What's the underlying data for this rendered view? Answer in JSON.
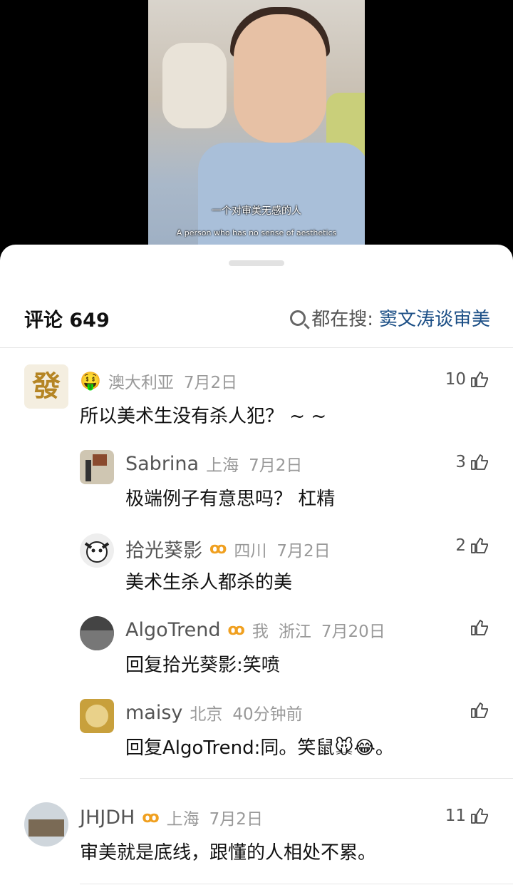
{
  "video": {
    "caption_cn": "一个对审美无感的人",
    "caption_en": "A person who has no sense of aesthetics"
  },
  "header": {
    "title": "评论 649",
    "search_prefix": "都在搜:",
    "search_term": "窦文涛谈审美"
  },
  "comments": [
    {
      "avatar_icon": "fa-character-avatar",
      "badge_emoji": "🤑",
      "location": "澳大利亚",
      "date": "7月2日",
      "text": "所以美术生没有杀人犯？ ~ ~",
      "likes": "10"
    },
    {
      "username": "Sabrina",
      "location": "上海",
      "date": "7月2日",
      "text": "极端例子有意思吗？ 杠精",
      "likes": "3"
    },
    {
      "username": "拾光葵影",
      "vip": "ꝏ",
      "location": "四川",
      "date": "7月2日",
      "text": "美术生杀人都杀的美",
      "likes": "2"
    },
    {
      "username": "AlgoTrend",
      "vip": "ꝏ",
      "tag": "我",
      "location": "浙江",
      "date": "7月20日",
      "text": "回复拾光葵影:笑喷",
      "likes": ""
    },
    {
      "username": "maisy",
      "location": "北京",
      "date": "40分钟前",
      "text": "回复AlgoTrend:同。笑鼠🐭😂。",
      "likes": ""
    },
    {
      "username": "JHJDH",
      "vip": "ꝏ",
      "location": "上海",
      "date": "7月2日",
      "text": "审美就是底线，跟懂的人相处不累。",
      "likes": "11"
    }
  ],
  "colors": {
    "accent_link": "#1c4f86",
    "vip": "#f0a020",
    "text": "#111111",
    "meta": "#999999"
  }
}
